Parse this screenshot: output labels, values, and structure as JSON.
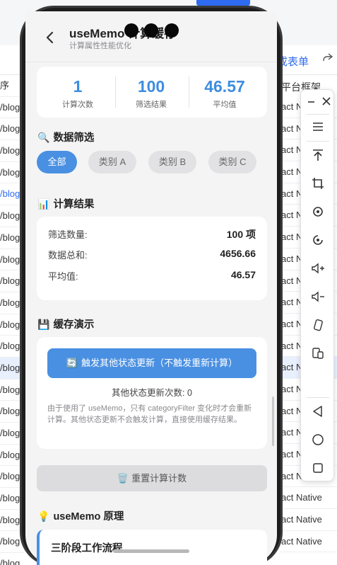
{
  "background_app": {
    "tool_label": "成表单",
    "column_header": "平台框架",
    "left_cells": [
      "序",
      "/blog",
      "/blog",
      "/blog",
      "/blog",
      "/blog",
      "/blog",
      "/blog",
      "/blog",
      "/blog",
      "/blog",
      "/blog",
      "/blog",
      "/blog",
      "/blog",
      "/blog",
      "/blog",
      "/blog",
      "/blog",
      "/blog",
      "/blog",
      "/blog",
      "/blog"
    ],
    "right_cells": [
      "act N",
      "act N",
      "act N",
      "act N",
      "act N",
      "act N",
      "act N",
      "act N",
      "act N",
      "act N",
      "act N",
      "act N",
      "act N",
      "act N",
      "act N",
      "act N",
      "act N",
      "act N",
      "act Native",
      "act Native",
      "act Native"
    ]
  },
  "nav": {
    "title": "useMemo 计算缓存",
    "subtitle": "计算属性性能优化"
  },
  "stats": [
    {
      "value": "1",
      "label": "计算次数"
    },
    {
      "value": "100",
      "label": "筛选结果"
    },
    {
      "value": "46.57",
      "label": "平均值"
    }
  ],
  "filter": {
    "title": "数据筛选",
    "icon": "🔍",
    "chips": [
      "全部",
      "类别 A",
      "类别 B",
      "类别 C"
    ],
    "active_index": 0
  },
  "result": {
    "title": "计算结果",
    "icon": "📊",
    "rows": [
      {
        "label": "筛选数量:",
        "value": "100 项"
      },
      {
        "label": "数据总和:",
        "value": "4656.66"
      },
      {
        "label": "平均值:",
        "value": "46.57"
      }
    ]
  },
  "cache": {
    "title": "缓存演示",
    "icon": "💾",
    "button_icon": "🔄",
    "button_label": "触发其他状态更新（不触发重新计算）",
    "other_count": "其他状态更新次数: 0",
    "note": "由于使用了 useMemo，只有 categoryFilter 变化时才会重新计算。其他状态更新不会触发计算，直接使用缓存结果。"
  },
  "reset": {
    "icon": "🗑️",
    "label": "重置计算计数"
  },
  "principle": {
    "icon": "💡",
    "title": "useMemo 原理",
    "card_title": "三阶段工作流程"
  },
  "colors": {
    "accent": "#4a90e2",
    "stat_value": "#3d8de0"
  }
}
